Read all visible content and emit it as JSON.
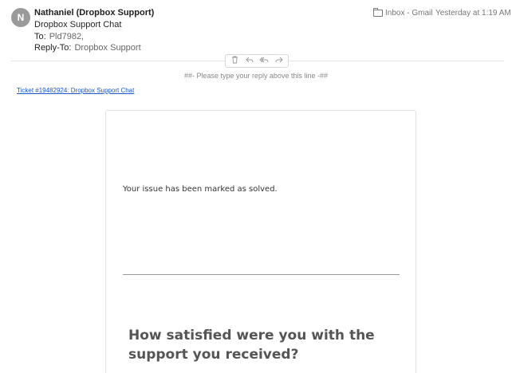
{
  "header": {
    "avatar_initial": "N",
    "sender": "Nathaniel (Dropbox Support)",
    "subject": "Dropbox Support Chat",
    "to_label": "To:",
    "to_value": "Pld7982,",
    "replyto_label": "Reply-To:",
    "replyto_value": "Dropbox Support",
    "mailbox": "Inbox - Gmail",
    "date": "Yesterday at 1:19 AM"
  },
  "actions": {
    "delete_icon": "trash-icon",
    "reply_icon": "reply-icon",
    "reply_all_icon": "reply-all-icon",
    "forward_icon": "forward-icon"
  },
  "body": {
    "reply_line": "##- Please type your reply above this line -##",
    "ticket_link": "Ticket #19482924: Dropbox Support Chat",
    "solved_text": "Your issue has been marked as solved.",
    "question": "How satisfied were you with the support you received?"
  },
  "colors": {
    "link": "#1a57c9",
    "avatar_bg": "#9a9a9a"
  }
}
